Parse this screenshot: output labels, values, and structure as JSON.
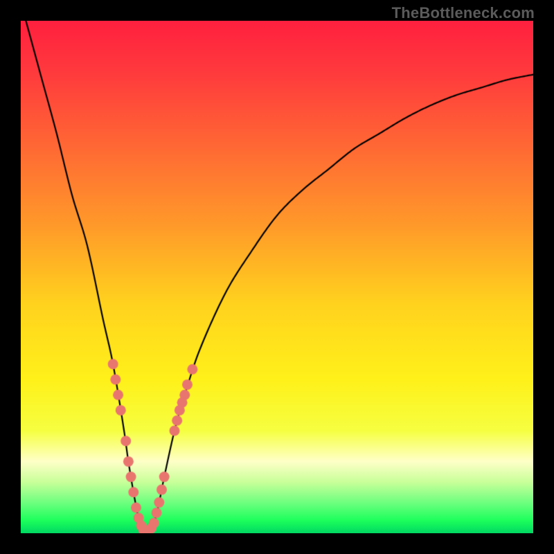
{
  "watermark": "TheBottleneck.com",
  "colors": {
    "frame": "#000000",
    "curve": "#000000",
    "dot": "#e8766f",
    "grad_stops": [
      {
        "p": 0.0,
        "c": "#ff203f"
      },
      {
        "p": 0.1,
        "c": "#ff3a3d"
      },
      {
        "p": 0.25,
        "c": "#ff6a34"
      },
      {
        "p": 0.4,
        "c": "#ff9a2a"
      },
      {
        "p": 0.55,
        "c": "#ffd21e"
      },
      {
        "p": 0.7,
        "c": "#fff11a"
      },
      {
        "p": 0.8,
        "c": "#f6ff41"
      },
      {
        "p": 0.86,
        "c": "#ffffc8"
      },
      {
        "p": 0.9,
        "c": "#c9ff9a"
      },
      {
        "p": 0.94,
        "c": "#6fff80"
      },
      {
        "p": 0.975,
        "c": "#1dff5c"
      },
      {
        "p": 1.0,
        "c": "#00d862"
      }
    ]
  },
  "chart_data": {
    "type": "line",
    "title": "",
    "xlabel": "",
    "ylabel": "",
    "xlim": [
      0,
      100
    ],
    "ylim": [
      0,
      100
    ],
    "grid": false,
    "legend": false,
    "description": "Bottleneck mismatch curve. X axis is relative component strength; Y axis is bottleneck severity (background: red=bad, green=good). Minimum (best match) occurs near x≈24, y≈0.",
    "series": [
      {
        "name": "bottleneck-curve",
        "x": [
          1,
          4,
          7,
          10,
          13,
          16,
          18,
          20,
          21,
          22,
          23,
          24,
          25,
          26,
          27,
          28,
          30,
          32,
          35,
          40,
          45,
          50,
          55,
          60,
          65,
          70,
          75,
          80,
          85,
          90,
          95,
          100
        ],
        "y": [
          100,
          89,
          78,
          66,
          56,
          42,
          33,
          21,
          14,
          8,
          3,
          0.5,
          0.5,
          2,
          6,
          11,
          20,
          27,
          36,
          47,
          55,
          62,
          67,
          71,
          75,
          78,
          81,
          83.5,
          85.5,
          87,
          88.5,
          89.5
        ]
      }
    ],
    "annotations": [
      {
        "name": "sample-dots",
        "note": "Highlighted sample points around the minimum.",
        "points": [
          {
            "x": 18,
            "y": 33
          },
          {
            "x": 18.5,
            "y": 30
          },
          {
            "x": 19,
            "y": 27
          },
          {
            "x": 19.5,
            "y": 24
          },
          {
            "x": 20.5,
            "y": 18
          },
          {
            "x": 21,
            "y": 14
          },
          {
            "x": 21.5,
            "y": 11
          },
          {
            "x": 22,
            "y": 8
          },
          {
            "x": 22.5,
            "y": 5
          },
          {
            "x": 23,
            "y": 3
          },
          {
            "x": 23.5,
            "y": 1.5
          },
          {
            "x": 24,
            "y": 0.5
          },
          {
            "x": 24.7,
            "y": 0.5
          },
          {
            "x": 25.5,
            "y": 1
          },
          {
            "x": 26,
            "y": 2
          },
          {
            "x": 26.5,
            "y": 4
          },
          {
            "x": 27,
            "y": 6
          },
          {
            "x": 27.5,
            "y": 8.5
          },
          {
            "x": 28,
            "y": 11
          },
          {
            "x": 30,
            "y": 20
          },
          {
            "x": 30.5,
            "y": 22
          },
          {
            "x": 31,
            "y": 24
          },
          {
            "x": 31.5,
            "y": 25.5
          },
          {
            "x": 32,
            "y": 27
          },
          {
            "x": 32.5,
            "y": 29
          },
          {
            "x": 33.5,
            "y": 32
          }
        ]
      }
    ]
  }
}
